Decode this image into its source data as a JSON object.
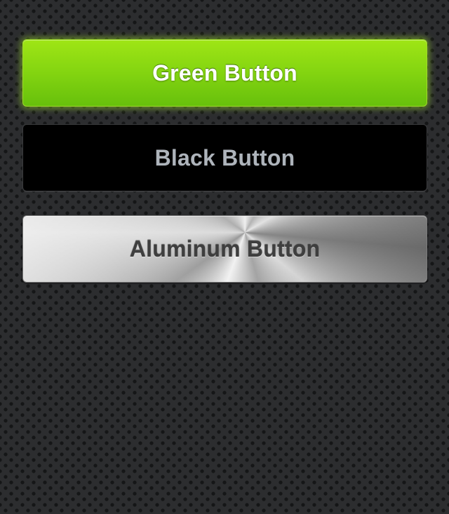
{
  "buttons": {
    "green": {
      "label": "Green Button"
    },
    "black": {
      "label": "Black Button"
    },
    "aluminum": {
      "label": "Aluminum Button"
    }
  },
  "colors": {
    "background": "#2c2d2f",
    "green_accent": "#86d611",
    "black_button": "#000000",
    "aluminum_button": "#c8c8c8"
  }
}
